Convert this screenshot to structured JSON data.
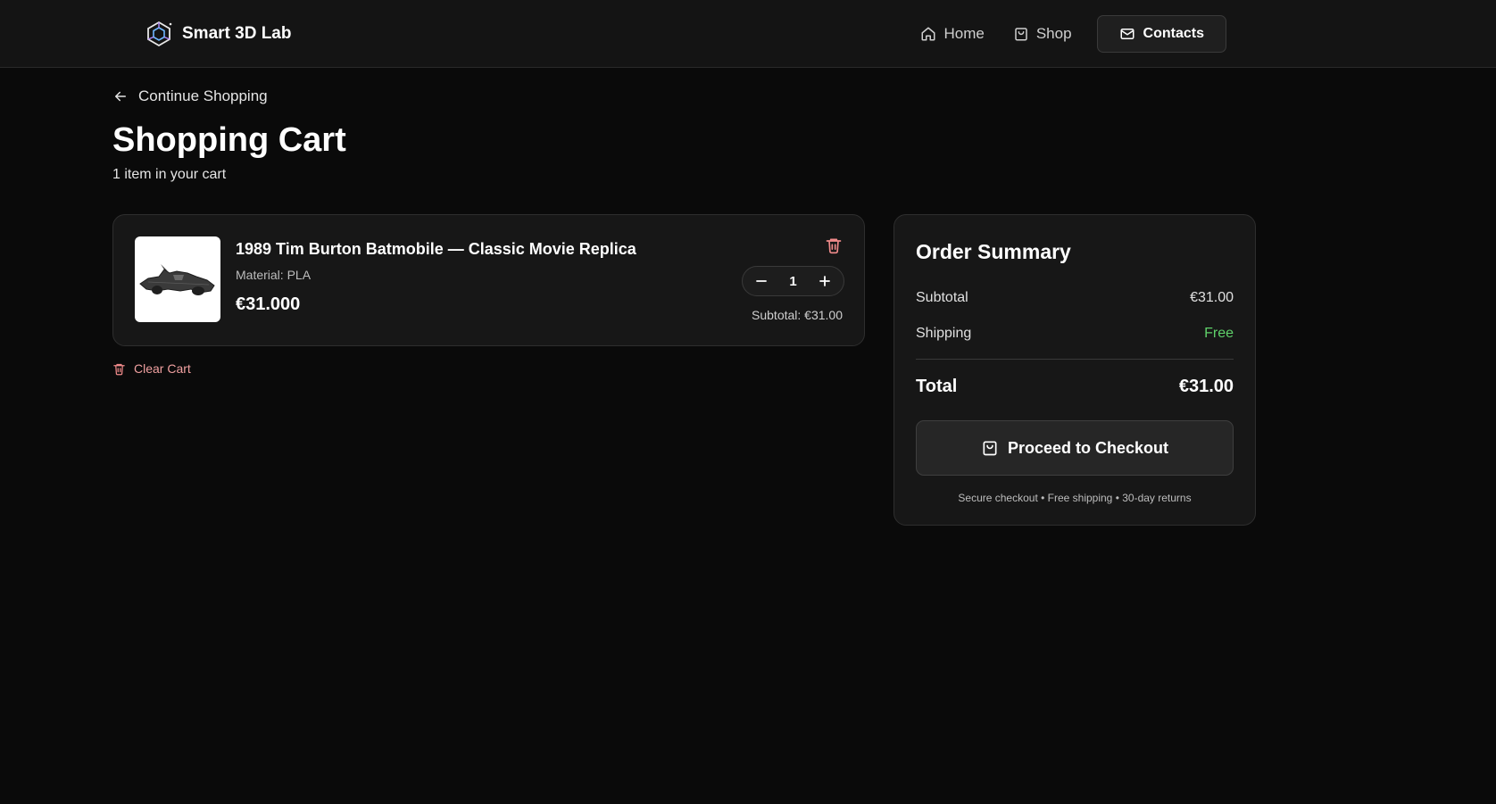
{
  "header": {
    "brand_name": "Smart 3D Lab",
    "nav": [
      {
        "label": "Home",
        "icon": "home-icon"
      },
      {
        "label": "Shop",
        "icon": "shopping-bag-icon"
      }
    ],
    "contacts_label": "Contacts",
    "contacts_icon": "mail-icon"
  },
  "page": {
    "back_label": "Continue Shopping",
    "title": "Shopping Cart",
    "item_count": "1 item in your cart"
  },
  "cart": {
    "items": [
      {
        "name": "1989 Tim Burton Batmobile — Classic Movie Replica",
        "material": "Material: PLA",
        "price": "€31.000",
        "quantity": "1",
        "subtotal": "Subtotal: €31.00"
      }
    ],
    "clear_label": "Clear Cart"
  },
  "summary": {
    "title": "Order Summary",
    "subtotal_label": "Subtotal",
    "subtotal_value": "€31.00",
    "shipping_label": "Shipping",
    "shipping_value": "Free",
    "total_label": "Total",
    "total_value": "€31.00",
    "checkout_label": "Proceed to Checkout",
    "note": "Secure checkout • Free shipping • 30-day returns"
  },
  "colors": {
    "background": "#0a0a0a",
    "card": "#171717",
    "accent_free": "#5fd16a",
    "danger": "#f0a0a0"
  }
}
